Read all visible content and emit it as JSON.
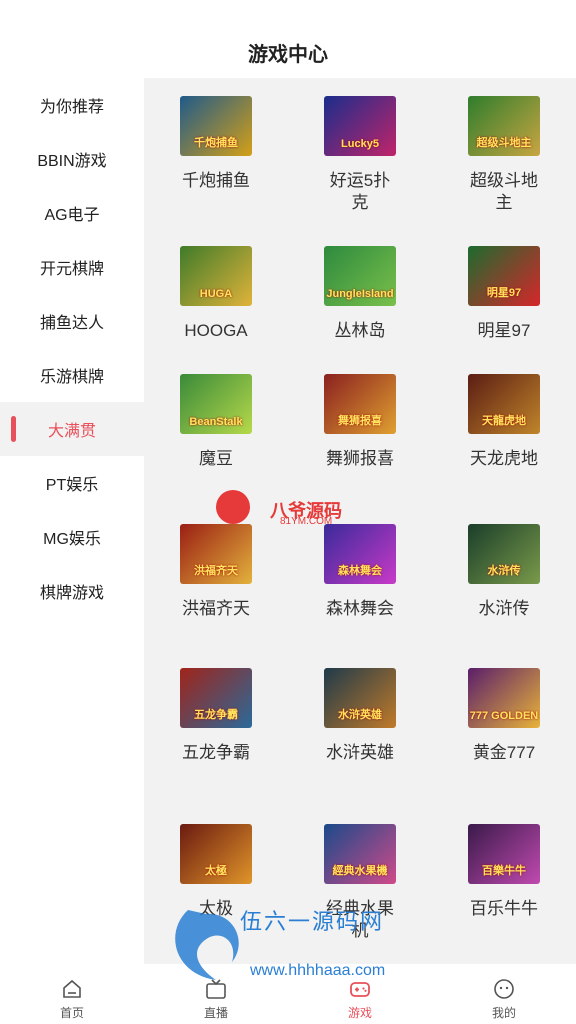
{
  "header": {
    "title": "游戏中心"
  },
  "sidebar": {
    "items": [
      {
        "label": "为你推荐",
        "active": false
      },
      {
        "label": "BBIN游戏",
        "active": false
      },
      {
        "label": "AG电子",
        "active": false
      },
      {
        "label": "开元棋牌",
        "active": false
      },
      {
        "label": "捕鱼达人",
        "active": false
      },
      {
        "label": "乐游棋牌",
        "active": false
      },
      {
        "label": "大满贯",
        "active": true
      },
      {
        "label": "PT娱乐",
        "active": false
      },
      {
        "label": "MG娱乐",
        "active": false
      },
      {
        "label": "棋牌游戏",
        "active": false
      }
    ]
  },
  "games": [
    {
      "name": "千炮捕鱼",
      "thumb_text": "千炮捕鱼",
      "bg": "#1f5a8a",
      "bg2": "#d4a017"
    },
    {
      "name": "好运5扑克",
      "thumb_text": "Lucky5",
      "bg": "#1a2d8c",
      "bg2": "#c0246a"
    },
    {
      "name": "超级斗地主",
      "thumb_text": "超级斗地主",
      "bg": "#2f7d2c",
      "bg2": "#c8a542"
    },
    {
      "name": "HOOGA",
      "thumb_text": "HUGA",
      "bg": "#3f7b2a",
      "bg2": "#e0b33a"
    },
    {
      "name": "丛林岛",
      "thumb_text": "JungleIsland",
      "bg": "#2d8a3e",
      "bg2": "#7ac04a"
    },
    {
      "name": "明星97",
      "thumb_text": "明星97",
      "bg": "#1c6b2f",
      "bg2": "#d7262a"
    },
    {
      "name": "魔豆",
      "thumb_text": "BeanStalk",
      "bg": "#3a8a3a",
      "bg2": "#b6d94a"
    },
    {
      "name": "舞狮报喜",
      "thumb_text": "舞狮报喜",
      "bg": "#8a2020",
      "bg2": "#e0a030"
    },
    {
      "name": "天龙虎地",
      "thumb_text": "天龍虎地",
      "bg": "#5a1d14",
      "bg2": "#c0852a"
    },
    {
      "name": "洪福齐天",
      "thumb_text": "洪福齐天",
      "bg": "#9a1e14",
      "bg2": "#e3b23c"
    },
    {
      "name": "森林舞会",
      "thumb_text": "森林舞会",
      "bg": "#3a2a9a",
      "bg2": "#c83ac8"
    },
    {
      "name": "水浒传",
      "thumb_text": "水浒传",
      "bg": "#1a3e2a",
      "bg2": "#7a9a4a"
    },
    {
      "name": "五龙争霸",
      "thumb_text": "五龙争霸",
      "bg": "#a0241a",
      "bg2": "#2a6a9a"
    },
    {
      "name": "水浒英雄",
      "thumb_text": "水浒英雄",
      "bg": "#1f3a4a",
      "bg2": "#c07a2a"
    },
    {
      "name": "黄金777",
      "thumb_text": "777 GOLDEN",
      "bg": "#5a1e6a",
      "bg2": "#e8b33a"
    },
    {
      "name": "太极",
      "thumb_text": "太極",
      "bg": "#6a1a10",
      "bg2": "#e0952a"
    },
    {
      "name": "经典水果机",
      "thumb_text": "經典水果機",
      "bg": "#1a4a8a",
      "bg2": "#d04a8a"
    },
    {
      "name": "百乐牛牛",
      "thumb_text": "百樂牛牛",
      "bg": "#3a1a4a",
      "bg2": "#c04ab0"
    }
  ],
  "tabbar": {
    "items": [
      {
        "label": "首页",
        "icon": "home-icon",
        "active": false
      },
      {
        "label": "直播",
        "icon": "live-tv-icon",
        "active": false
      },
      {
        "label": "游戏",
        "icon": "gamepad-icon",
        "active": true
      },
      {
        "label": "我的",
        "icon": "profile-icon",
        "active": false
      }
    ]
  },
  "watermarks": {
    "top_brand": "八爷源码",
    "top_url": "81YM.COM",
    "bottom_brand": "伍六一源码网",
    "bottom_url": "www.hhhhaaa.com"
  },
  "colors": {
    "accent": "#e8505b",
    "content_bg": "#f2f2f2",
    "watermark_blue": "#2a7fd4",
    "watermark_red": "#e63a3a"
  }
}
